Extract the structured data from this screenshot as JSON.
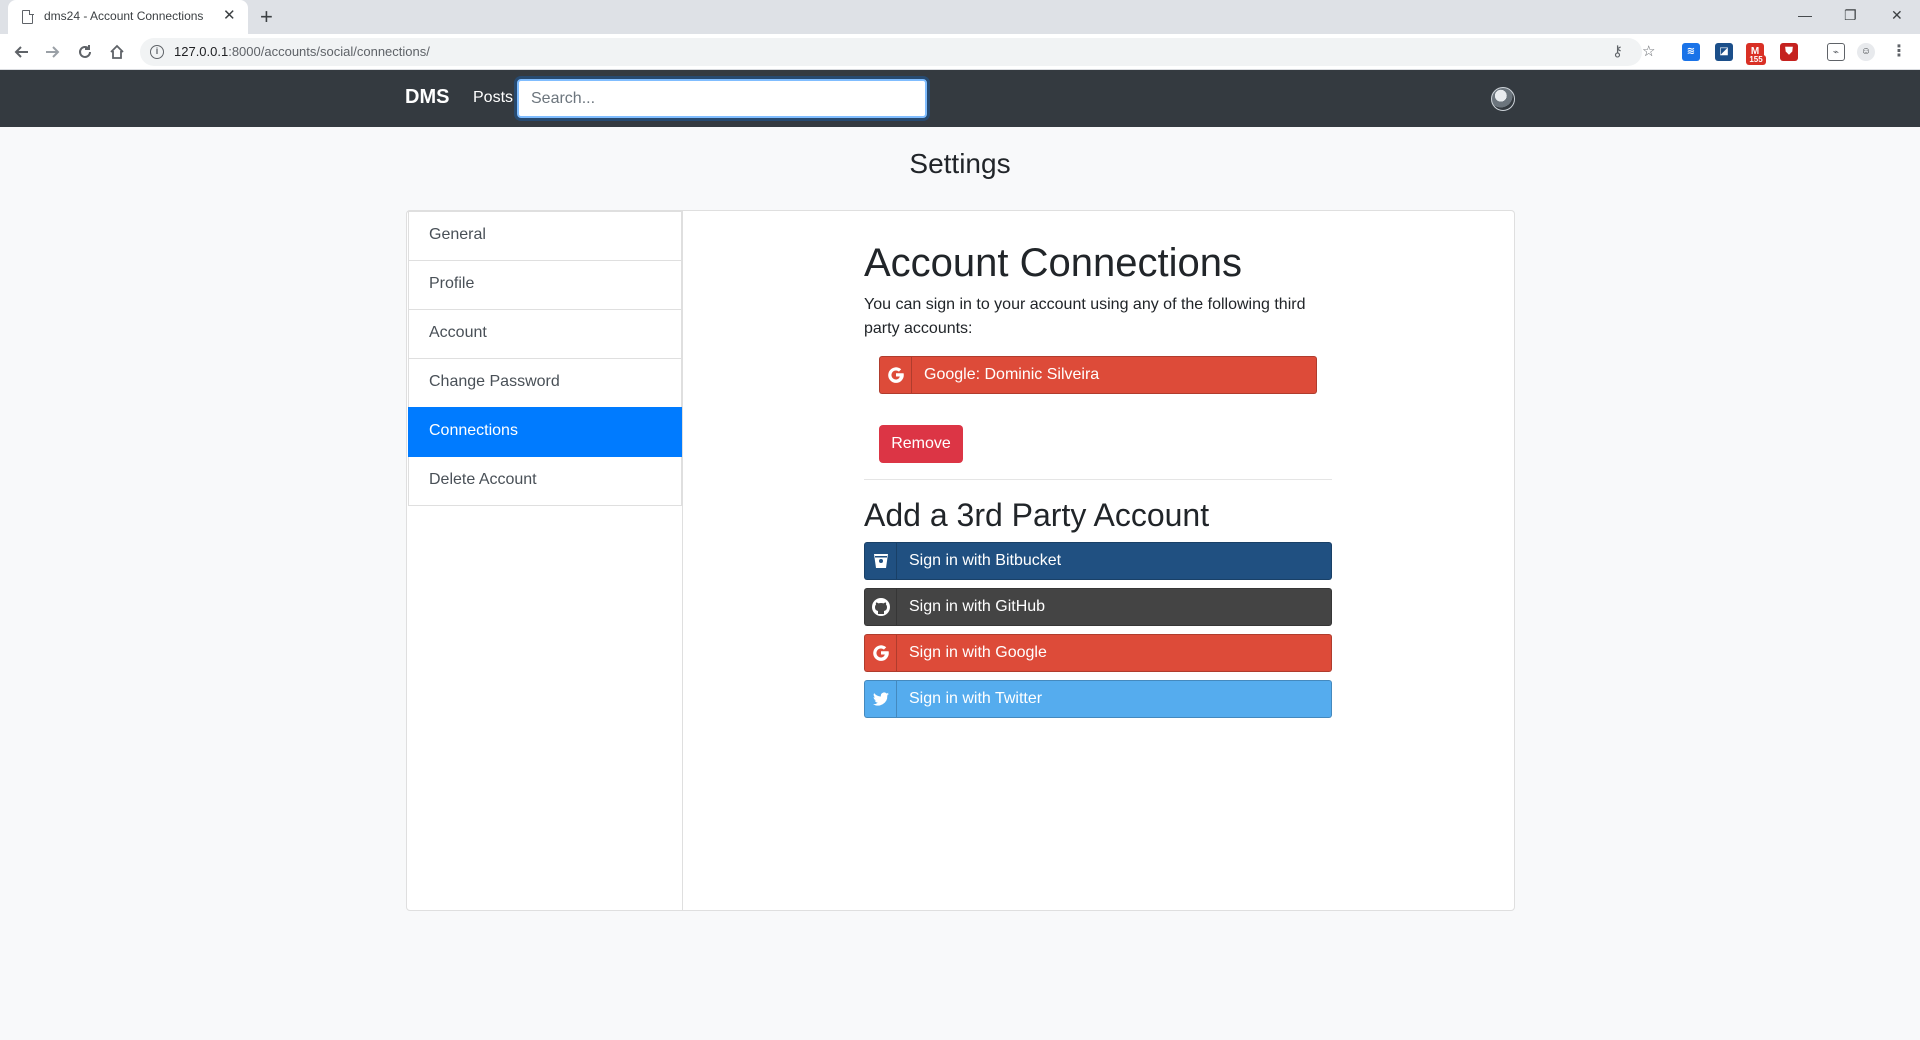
{
  "browser": {
    "tab_title": "dms24 - Account Connections",
    "url_host": "127.0.0.1",
    "url_path": ":8000/accounts/social/connections/",
    "extension_badge": "155"
  },
  "navbar": {
    "brand": "DMS",
    "posts_link": "Posts",
    "search_placeholder": "Search..."
  },
  "page": {
    "title": "Settings"
  },
  "sidebar": {
    "items": [
      {
        "label": "General"
      },
      {
        "label": "Profile"
      },
      {
        "label": "Account"
      },
      {
        "label": "Change Password"
      },
      {
        "label": "Connections",
        "active": true
      },
      {
        "label": "Delete Account"
      }
    ]
  },
  "connections": {
    "heading": "Account Connections",
    "description": "You can sign in to your account using any of the following third party accounts:",
    "connected_account": "Google: Dominic Silveira",
    "remove_label": "Remove"
  },
  "add_account": {
    "heading": "Add a 3rd Party Account",
    "providers": [
      {
        "label": "Sign in with Bitbucket",
        "color": "#205081",
        "icon": "bitbucket-icon"
      },
      {
        "label": "Sign in with GitHub",
        "color": "#444444",
        "icon": "github-icon"
      },
      {
        "label": "Sign in with Google",
        "color": "#dd4b39",
        "icon": "google-icon"
      },
      {
        "label": "Sign in with Twitter",
        "color": "#55acee",
        "icon": "twitter-icon"
      }
    ]
  },
  "colors": {
    "active": "#007bff",
    "danger": "#dc3545",
    "navbar": "#343a40"
  }
}
